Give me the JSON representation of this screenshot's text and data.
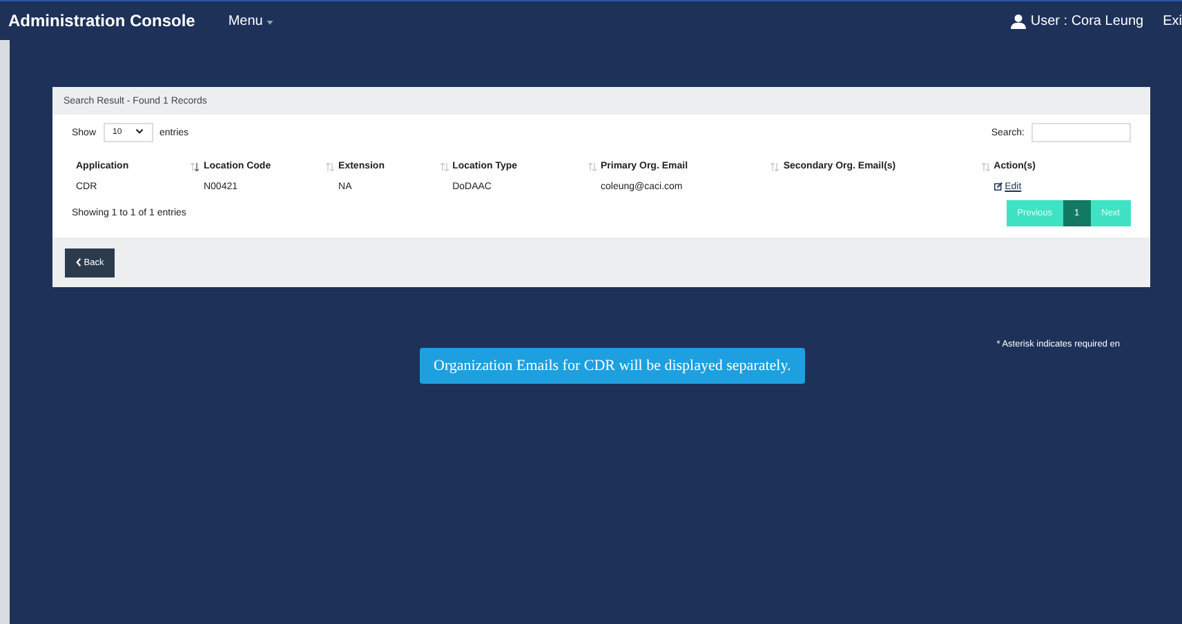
{
  "header": {
    "title": "Administration Console",
    "menu": "Menu",
    "user": "User : Cora Leung",
    "exit": "Exi"
  },
  "panel": {
    "title": "Search Result - Found 1 Records",
    "show_label": "Show",
    "page_size": "10",
    "entries_label": "entries",
    "search_label": "Search:",
    "table": {
      "columns": [
        {
          "label": "Application",
          "sorted": true
        },
        {
          "label": "Location Code",
          "sorted": false
        },
        {
          "label": "Extension",
          "sorted": false
        },
        {
          "label": "Location Type",
          "sorted": false
        },
        {
          "label": "Primary Org. Email",
          "sorted": false
        },
        {
          "label": "Secondary Org. Email(s)",
          "sorted": false
        },
        {
          "label": "Action(s)"
        }
      ],
      "rows": [
        {
          "cells": [
            "CDR",
            "N00421",
            "NA",
            "DoDAAC",
            "coleung@caci.com",
            ""
          ],
          "action": "Edit"
        }
      ]
    },
    "info": "Showing 1 to 1 of 1 entries",
    "pagination": [
      {
        "label": "Previous",
        "selected": false
      },
      {
        "label": "1",
        "selected": true
      },
      {
        "label": "Next",
        "selected": false
      }
    ],
    "back": "Back"
  },
  "note": "* Asterisk indicates required en",
  "tooltip": "Organization Emails for CDR will be displayed separately."
}
